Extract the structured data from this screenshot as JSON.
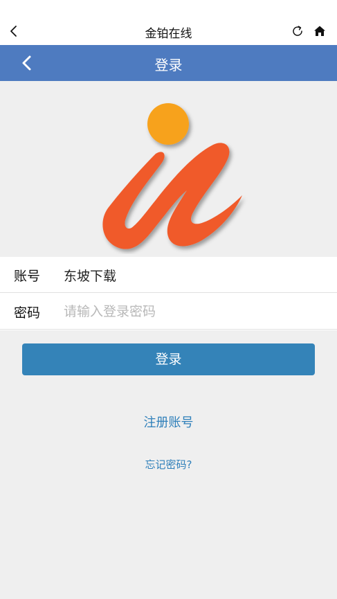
{
  "browser": {
    "title": "金铂在线",
    "icons": [
      "chevron-left-icon",
      "refresh-icon",
      "home-icon"
    ]
  },
  "header": {
    "title": "登录",
    "icons": [
      "chevron-left-icon"
    ]
  },
  "logo": {
    "name": "app-logo",
    "colors": {
      "dot": "#f7a21e",
      "stroke": "#f05a2b"
    }
  },
  "form": {
    "account_label": "账号",
    "account_value": "东坡下载",
    "password_label": "密码",
    "password_placeholder": "请输入登录密码"
  },
  "login_button": "登录",
  "register_link": "注册账号",
  "forgot_link": "忘记密码?",
  "colors": {
    "header_bg": "#4e7bc0",
    "button_bg": "#3483b8",
    "link": "#2e7fba",
    "page_bg": "#efefef"
  }
}
